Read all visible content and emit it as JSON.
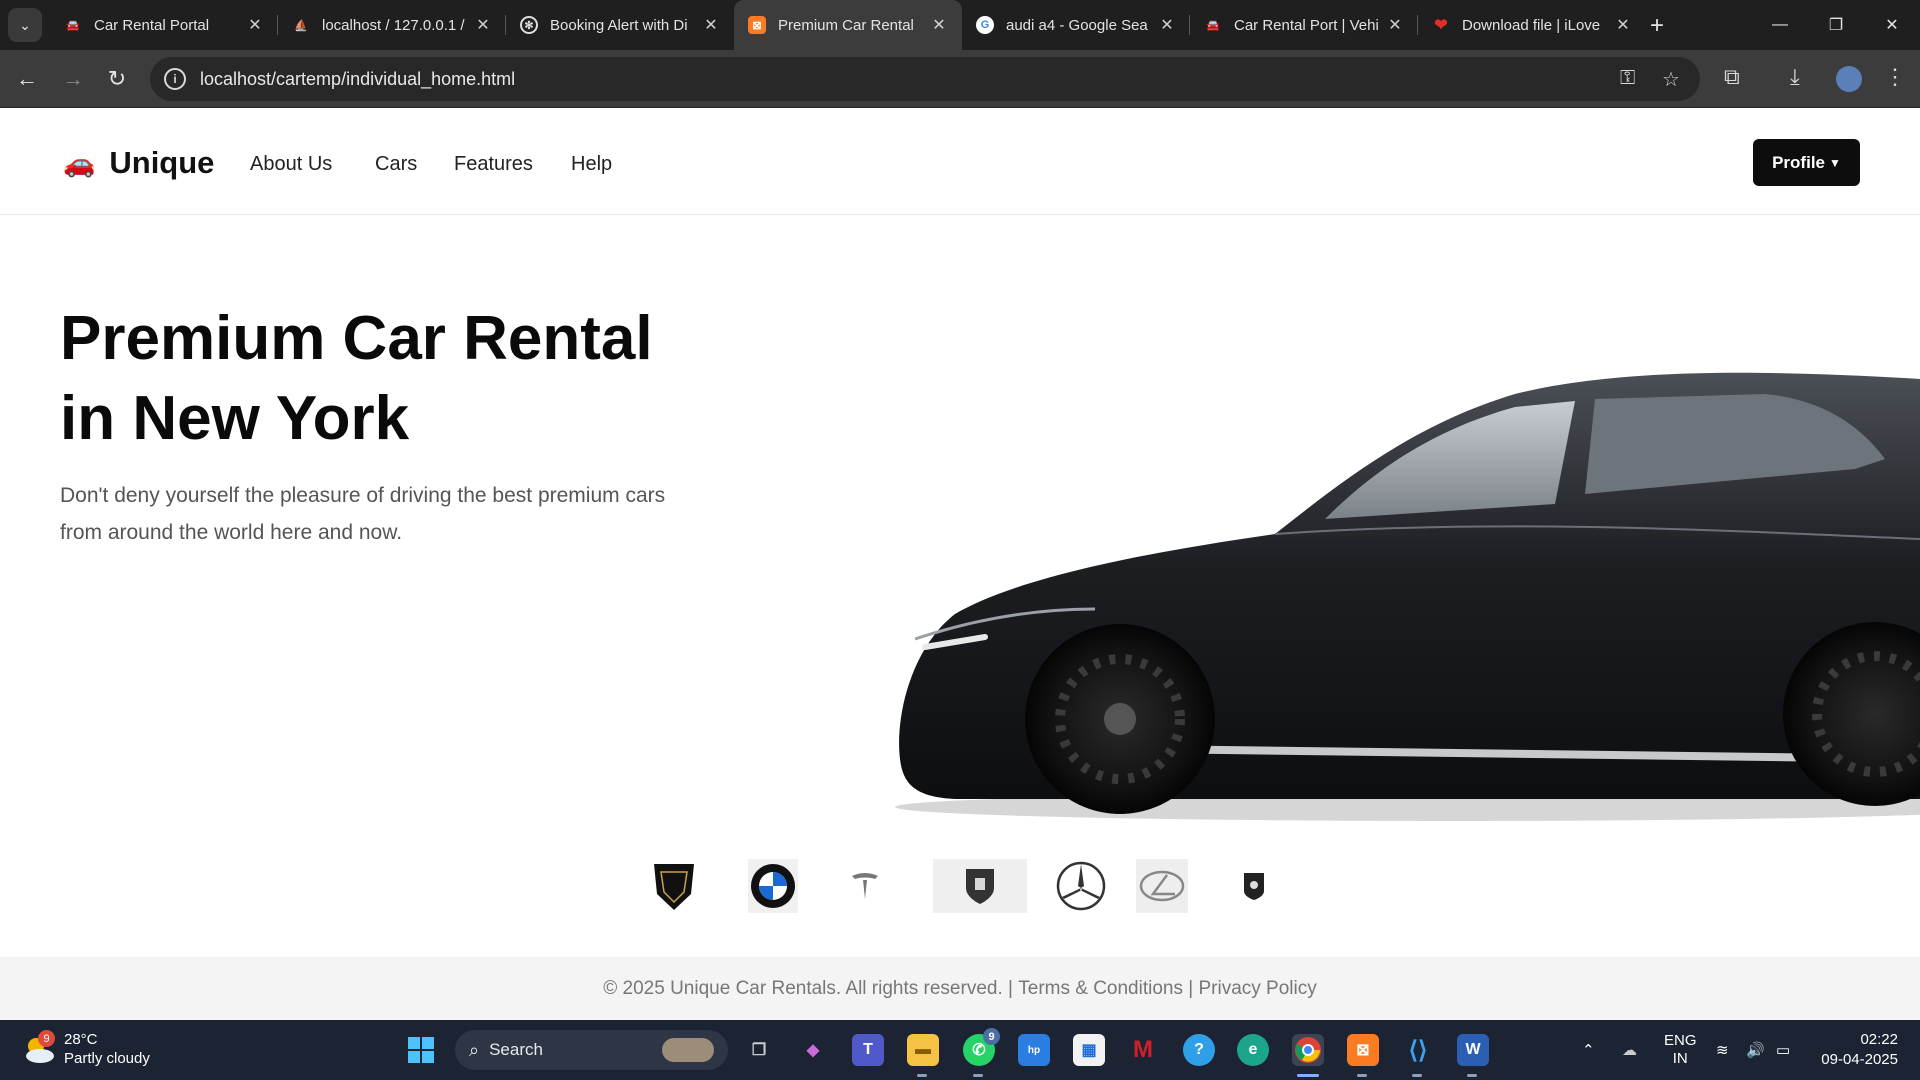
{
  "browser": {
    "tabs": [
      {
        "title": "Car Rental Portal",
        "active": false,
        "favicon": "car-favicon"
      },
      {
        "title": "localhost / 127.0.0.1 / ",
        "active": false,
        "favicon": "phpmyadmin-favicon"
      },
      {
        "title": "Booking Alert with Di",
        "active": false,
        "favicon": "chatgpt-favicon"
      },
      {
        "title": "Premium Car Rental",
        "active": true,
        "favicon": "xampp-favicon"
      },
      {
        "title": "audi a4 - Google Sea",
        "active": false,
        "favicon": "google-favicon"
      },
      {
        "title": "Car Rental Port | Vehi",
        "active": false,
        "favicon": "car-favicon"
      },
      {
        "title": "Download file | iLove",
        "active": false,
        "favicon": "heart-favicon"
      }
    ],
    "url": "localhost/cartemp/individual_home.html"
  },
  "site": {
    "brand": "Unique",
    "nav": [
      "About Us",
      "Cars",
      "Features",
      "Help"
    ],
    "profile_label": "Profile",
    "hero_title": "Premium Car Rental in New York",
    "hero_subtitle": "Don't deny yourself the pleasure of driving the best premium cars from around the world here and now.",
    "brand_logos": [
      "lamborghini-logo",
      "bmw-logo",
      "tesla-logo",
      "porsche-logo",
      "mercedes-logo",
      "lexus-logo",
      "ferrari-logo"
    ],
    "footer": {
      "copyright": "© 2025 Unique Car Rentals. All rights reserved.",
      "separator": "|",
      "terms": "Terms & Conditions",
      "privacy": "Privacy Policy"
    }
  },
  "taskbar": {
    "weather_temp": "28°C",
    "weather_desc": "Partly cloudy",
    "weather_badge": "9",
    "search_label": "Search",
    "whatsapp_badge": "9",
    "lang_top": "ENG",
    "lang_bottom": "IN",
    "time": "02:22",
    "date": "09-04-2025"
  },
  "colors": {
    "chrome_dark": "#1f1f1f",
    "toolbar": "#3c3c3c",
    "profile_button": "#0d0d0d",
    "footer_bg": "#f4f4f4",
    "taskbar": "#1c2433"
  }
}
